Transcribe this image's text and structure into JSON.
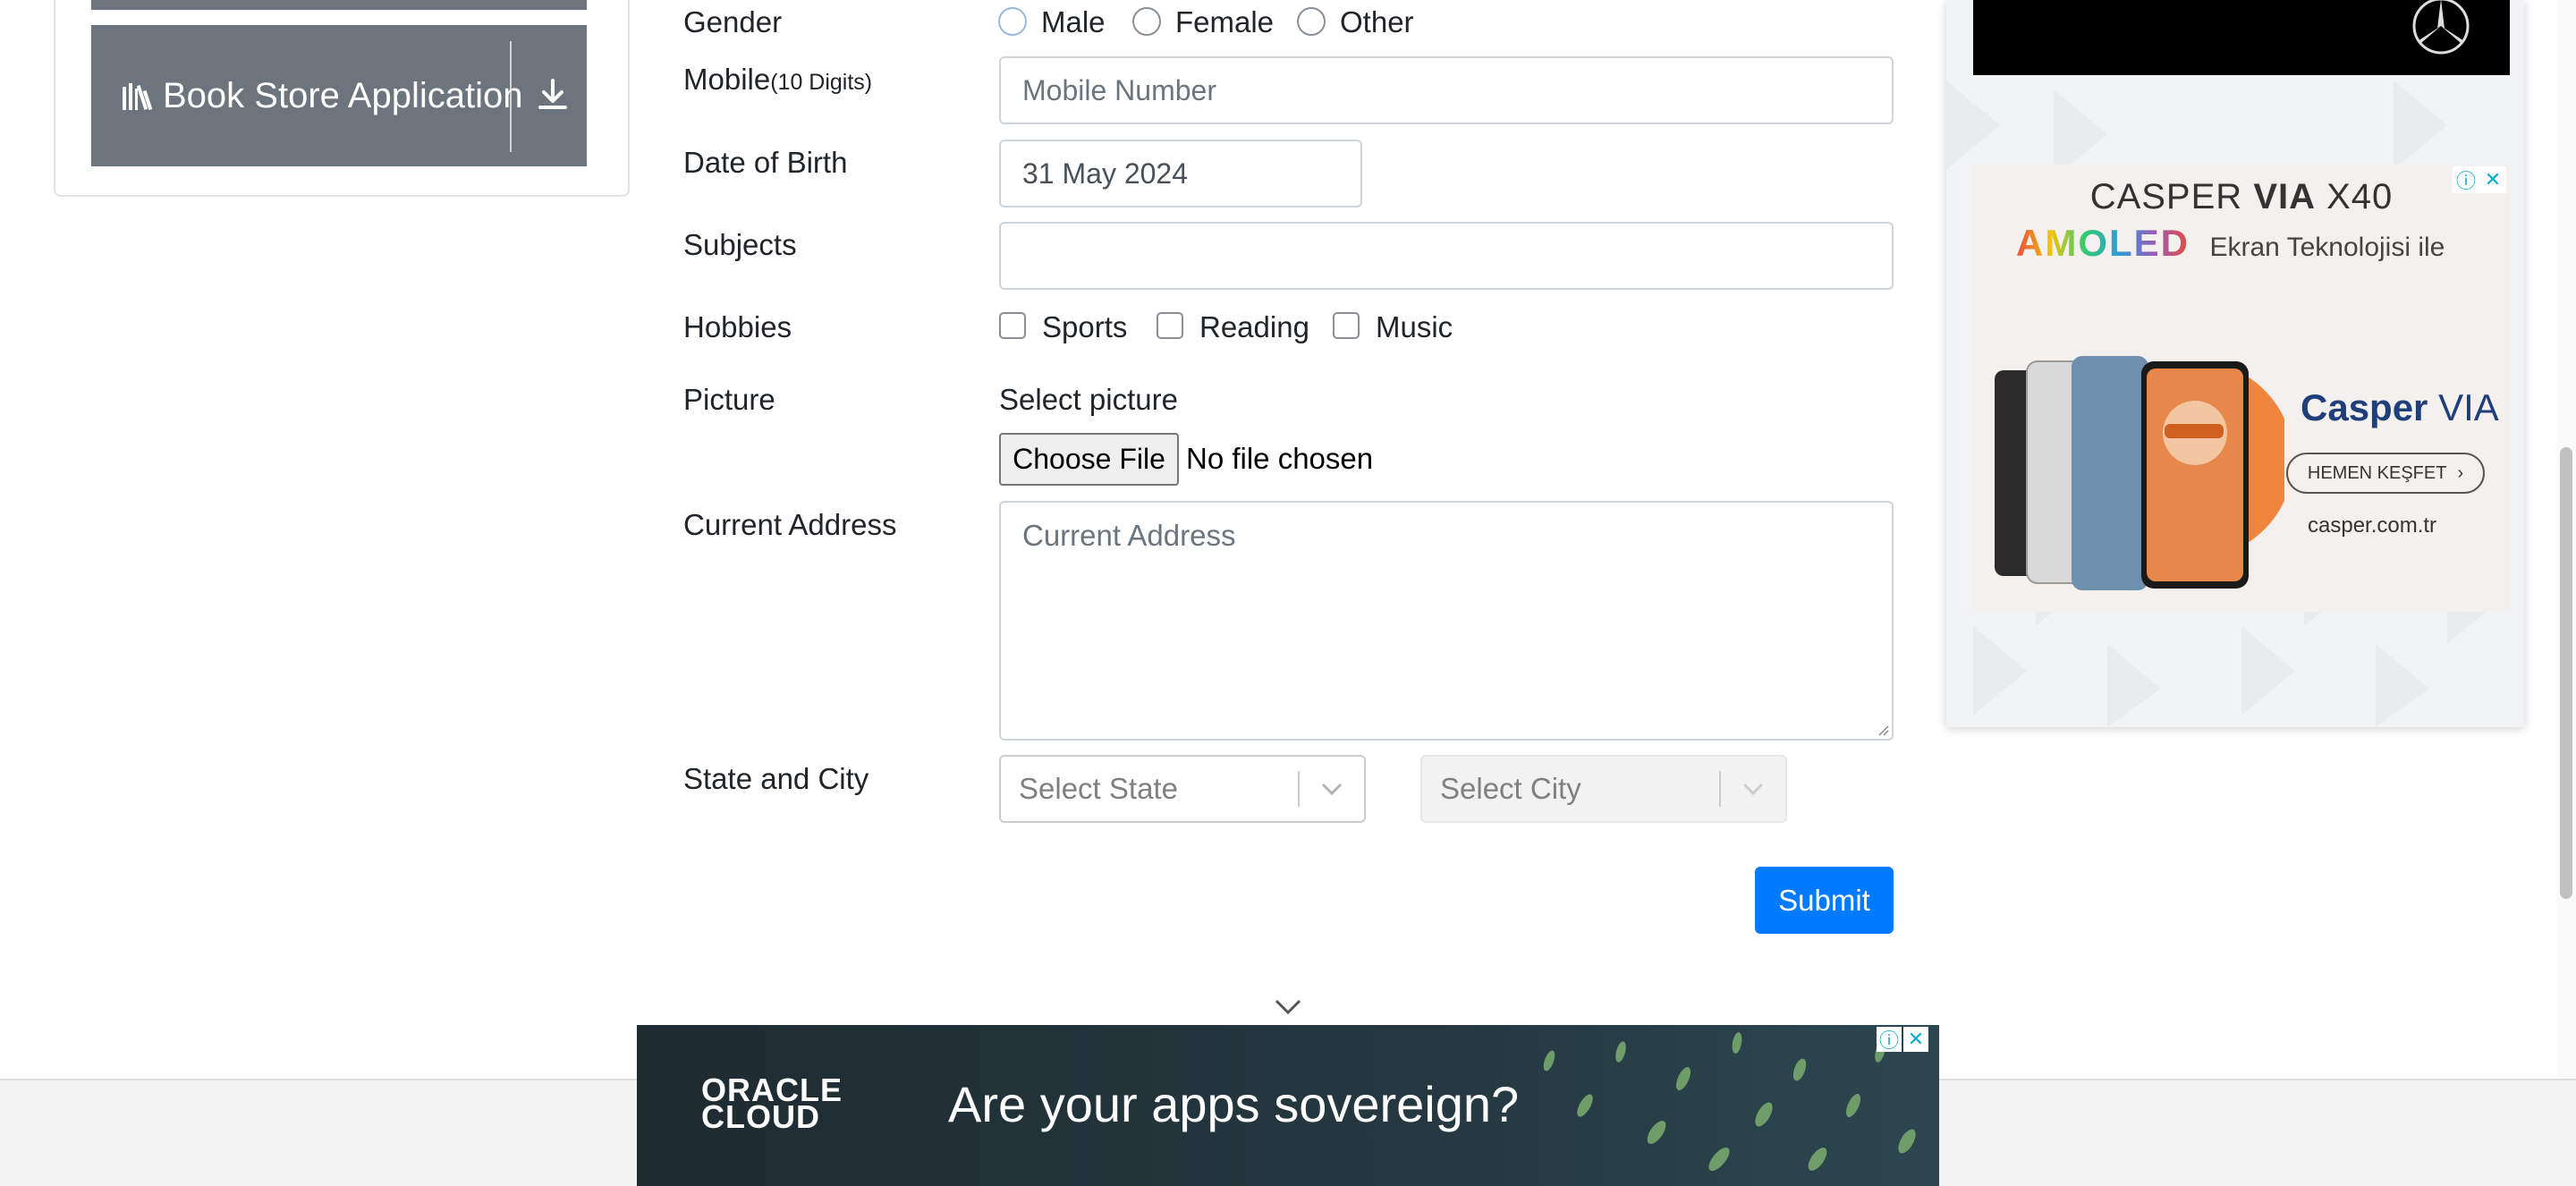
{
  "sidebar": {
    "book_store_label": "Book Store Application"
  },
  "form": {
    "gender": {
      "label": "Gender",
      "options": [
        "Male",
        "Female",
        "Other"
      ]
    },
    "mobile": {
      "label": "Mobile",
      "hint": "(10 Digits)",
      "placeholder": "Mobile Number"
    },
    "dob": {
      "label": "Date of Birth",
      "value": "31 May 2024"
    },
    "subjects": {
      "label": "Subjects",
      "value": ""
    },
    "hobbies": {
      "label": "Hobbies",
      "options": [
        "Sports",
        "Reading",
        "Music"
      ]
    },
    "picture": {
      "label": "Picture",
      "select_label": "Select picture",
      "choose_file": "Choose File",
      "no_file": "No file chosen"
    },
    "address": {
      "label": "Current Address",
      "placeholder": "Current Address"
    },
    "state_city": {
      "label": "State and City",
      "state_placeholder": "Select State",
      "city_placeholder": "Select City"
    },
    "submit_label": "Submit"
  },
  "right_ad": {
    "title_plain": "CASPER",
    "title_bold": "VIA",
    "title_model": "X40",
    "amoled": "AMOLED",
    "ekran": "Ekran Teknolojisi ile",
    "brand": "Casper",
    "brand_suffix": "VIA",
    "cta": "HEMEN KEŞFET",
    "url": "casper.com.tr"
  },
  "bottom_ad": {
    "logo_line1": "ORACLE",
    "logo_line2": "CLOUD",
    "headline": "Are your apps sovereign?"
  },
  "colors": {
    "primary": "#007bff",
    "secondary": "#6c757d",
    "border": "#ced4da"
  }
}
